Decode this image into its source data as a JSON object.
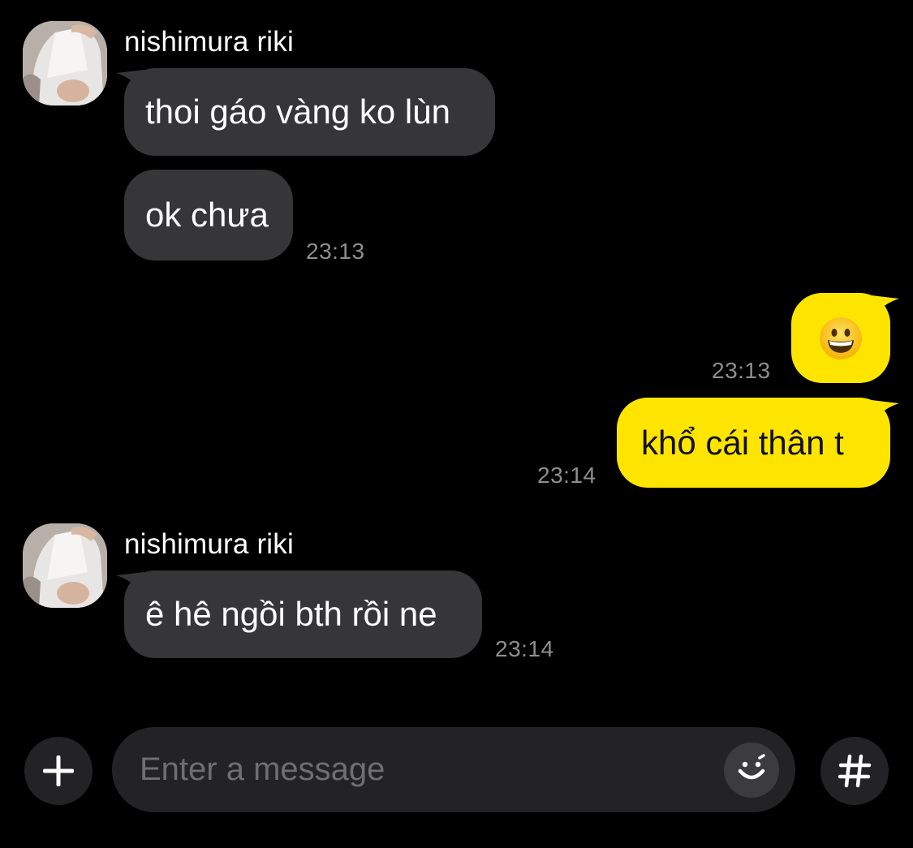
{
  "messages": [
    {
      "sender": "nishimura riki",
      "bubbles": [
        {
          "text": "thoi gáo vàng ko lùn"
        },
        {
          "text": "ok chưa",
          "time": "23:13"
        }
      ]
    },
    {
      "sender": "me",
      "bubbles": [
        {
          "emoji": "grinning-face",
          "time": "23:13"
        },
        {
          "text": "khổ cái thân t",
          "time": "23:14"
        }
      ]
    },
    {
      "sender": "nishimura riki",
      "bubbles": [
        {
          "text": "ê hê ngồi bth rồi ne",
          "time": "23:14"
        }
      ]
    }
  ],
  "composer": {
    "placeholder": "Enter a message",
    "value": "",
    "add_icon": "plus-icon",
    "emoji_icon": "smiley-icon",
    "hashtag_icon": "hash-icon"
  },
  "colors": {
    "background": "#000000",
    "incoming_bubble": "#363638",
    "outgoing_bubble": "#fee500",
    "timestamp": "#8e8e90",
    "composer": "#232325"
  }
}
